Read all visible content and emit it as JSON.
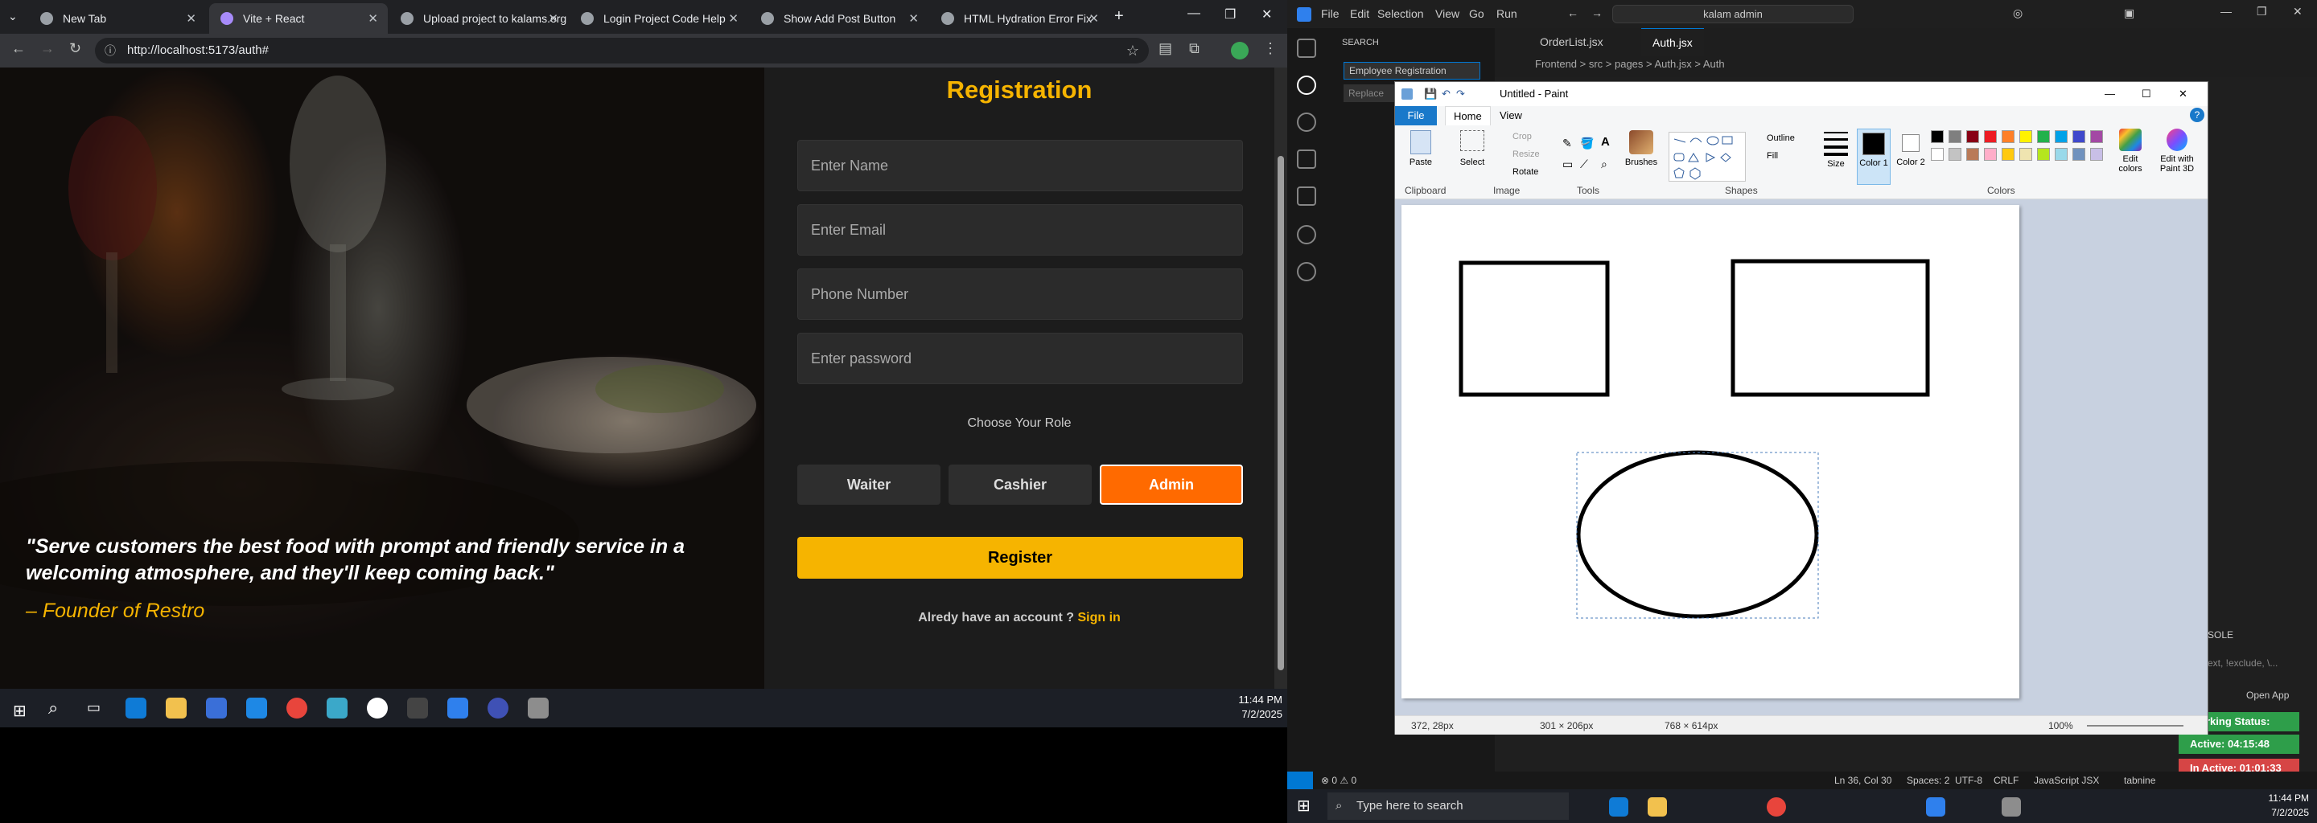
{
  "browser": {
    "tabs": [
      {
        "label": "New Tab"
      },
      {
        "label": "Vite + React"
      },
      {
        "label": "Upload project to kalams.org"
      },
      {
        "label": "Login Project Code Help"
      },
      {
        "label": "Show Add Post Button"
      },
      {
        "label": "HTML Hydration Error Fix"
      }
    ],
    "url": "http://localhost:5173/auth#"
  },
  "registration": {
    "title": "Registration",
    "name_placeholder": "Enter Name",
    "email_placeholder": "Enter Email",
    "phone_placeholder": "Phone Number",
    "password_placeholder": "Enter password",
    "role_label": "Choose Your Role",
    "roles": [
      "Waiter",
      "Cashier",
      "Admin"
    ],
    "selected_role": "Admin",
    "register_label": "Register",
    "account_text": "Alredy have an account ?",
    "signin_label": "Sign in"
  },
  "hero": {
    "quote": "\"Serve customers the best food with prompt and friendly service in a welcoming atmosphere, and they'll keep coming back.\"",
    "author": "– Founder of Restro"
  },
  "taskbar_left": {
    "time": "11:44 PM",
    "date": "7/2/2025"
  },
  "vscode": {
    "menu": [
      "File",
      "Edit",
      "Selection",
      "View",
      "Go",
      "Run"
    ],
    "search_box": "kalam admin",
    "sidebar_title": "SEARCH",
    "search_value": "Employee Registration",
    "replace_placeholder": "Replace",
    "editor_tabs": [
      "OrderList.jsx",
      "Auth.jsx"
    ],
    "breadcrumb": "Frontend > src > pages > Auth.jsx > Auth",
    "status": {
      "errors": "⊗ 0 ⚠ 0",
      "position": "Ln 36, Col 30",
      "spaces": "Spaces: 2",
      "encoding": "UTF-8",
      "eol": "CRLF",
      "language": "JavaScript JSX",
      "tabnine": "tabnine"
    },
    "panel_label": "SOLE",
    "panel_filter": "ext, !exclude, \\...",
    "open_app": "Open App"
  },
  "work_status": {
    "working": "Working Status: Active",
    "active": "Active: 04:15:48",
    "inactive": "In Active: 01:01:33",
    "colors": {
      "working": "#2e9e4a",
      "active": "#2e9e4a",
      "inactive": "#d64545"
    }
  },
  "paint": {
    "title": "Untitled - Paint",
    "menu": [
      "File",
      "Home",
      "View"
    ],
    "groups": [
      "Clipboard",
      "Image",
      "Tools",
      "Shapes",
      "Colors"
    ],
    "buttons": {
      "paste": "Paste",
      "select": "Select",
      "crop": "Crop",
      "resize": "Resize",
      "rotate": "Rotate",
      "brushes": "Brushes",
      "outline": "Outline",
      "fill": "Fill",
      "size": "Size",
      "color1": "Color 1",
      "color2": "Color 2",
      "edit_colors": "Edit colors",
      "edit_paint3d": "Edit with Paint 3D"
    },
    "palette": [
      "#000000",
      "#7f7f7f",
      "#880015",
      "#ed1c24",
      "#ff7f27",
      "#fff200",
      "#22b14c",
      "#00a2e8",
      "#3f48cc",
      "#a349a4",
      "#ffffff",
      "#c3c3c3",
      "#b97a57",
      "#ffaec9",
      "#ffc90e",
      "#efe4b0",
      "#b5e61d",
      "#99d9ea",
      "#7092be",
      "#c8bfe7"
    ],
    "status": {
      "cursor": "372, 28px",
      "selection": "301 × 206px",
      "canvas": "768 × 614px",
      "zoom": "100%"
    }
  },
  "taskbar_right": {
    "search_placeholder": "Type here to search",
    "time": "11:44 PM",
    "date": "7/2/2025"
  }
}
